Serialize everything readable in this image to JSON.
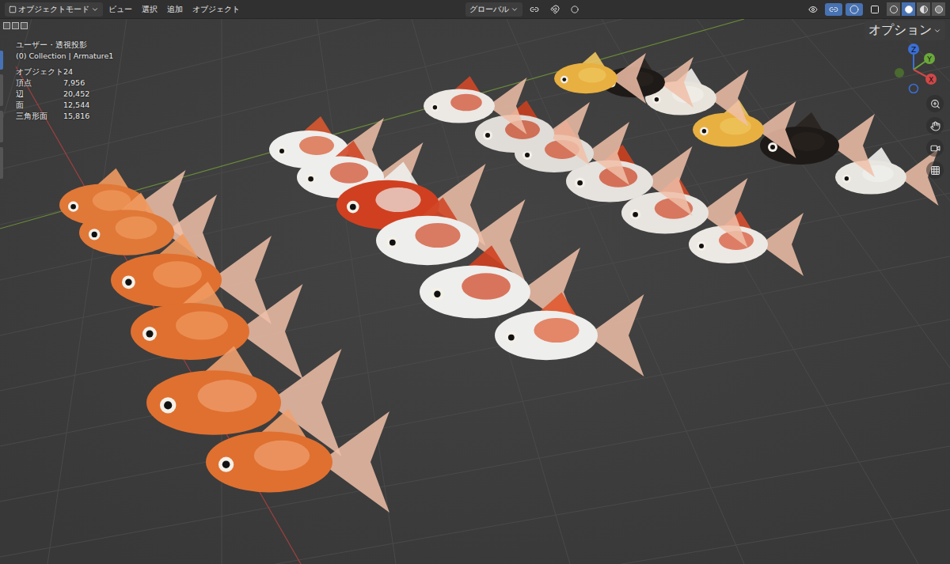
{
  "header": {
    "mode": "オブジェクトモード",
    "menus": [
      "ビュー",
      "選択",
      "追加",
      "オブジェクト"
    ],
    "transform_orientation": "グローバル",
    "options": "オプション"
  },
  "toggles": [
    {
      "name": "visibility",
      "on": false
    },
    {
      "name": "gizmos",
      "on": true
    },
    {
      "name": "overlays",
      "on": true
    },
    {
      "name": "xray",
      "on": false
    }
  ],
  "shading": [
    {
      "mode": "wireframe",
      "selected": false
    },
    {
      "mode": "solid",
      "selected": true
    },
    {
      "mode": "material",
      "selected": false
    },
    {
      "mode": "rendered",
      "selected": false
    }
  ],
  "viewport": {
    "view_name": "ユーザー・透視投影",
    "collection": "(0) Collection | Armature1",
    "stats": [
      {
        "label": "オブジェクト",
        "value": "24"
      },
      {
        "label": "頂点",
        "value": "7,956"
      },
      {
        "label": "辺",
        "value": "20,452"
      },
      {
        "label": "面",
        "value": "12,544"
      },
      {
        "label": "三角形面",
        "value": "15,816"
      }
    ]
  },
  "gizmo": {
    "axes": [
      "Z",
      "Y",
      "X"
    ]
  }
}
